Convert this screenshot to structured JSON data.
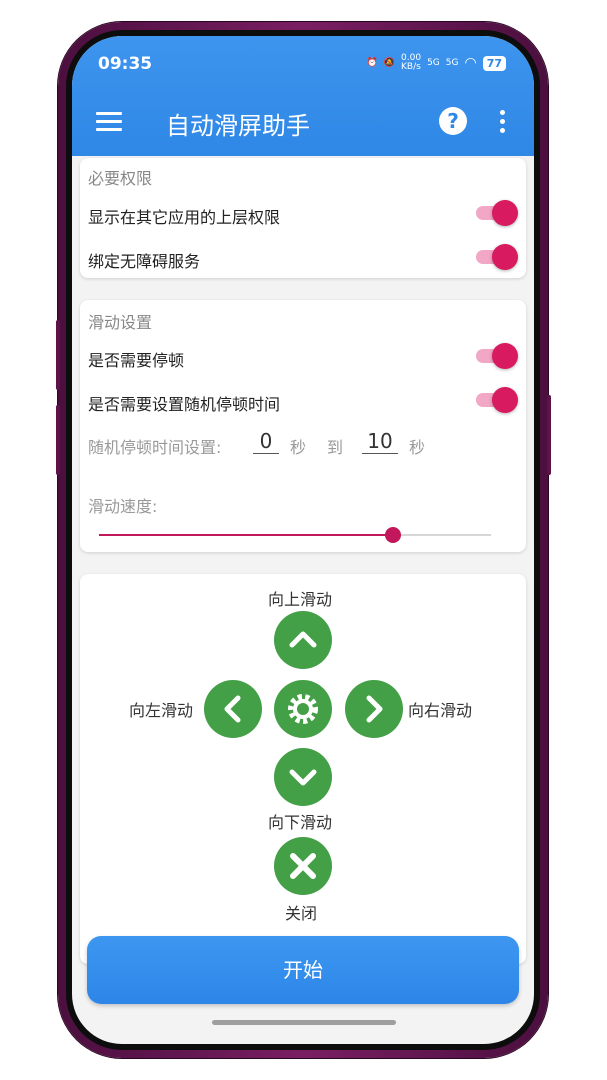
{
  "status_bar": {
    "time": "09:35",
    "network_speed": "0.00\nKB/s",
    "signal1": "5G",
    "signal2": "5G",
    "battery": "77"
  },
  "app_bar": {
    "title": "自动滑屏助手",
    "help_label": "?"
  },
  "permissions": {
    "title": "必要权限",
    "items": [
      {
        "label": "显示在其它应用的上层权限",
        "enabled": true
      },
      {
        "label": "绑定无障碍服务",
        "enabled": true
      }
    ]
  },
  "swipe_settings": {
    "title": "滑动设置",
    "pause_label": "是否需要停顿",
    "pause_enabled": true,
    "random_label": "是否需要设置随机停顿时间",
    "random_enabled": true,
    "random_time_label": "随机停顿时间设置:",
    "random_min": "0",
    "unit_sec": "秒",
    "to_label": "到",
    "random_max": "10",
    "unit_sec2": "秒",
    "speed_label": "滑动速度:",
    "speed_fraction": 0.75
  },
  "controls": {
    "up": "向上滑动",
    "left": "向左滑动",
    "right": "向右滑动",
    "down": "向下滑动",
    "close": "关闭"
  },
  "start_button": "开始",
  "colors": {
    "primary": "#2f87e6",
    "accent": "#d81b60",
    "green": "#43a047"
  }
}
